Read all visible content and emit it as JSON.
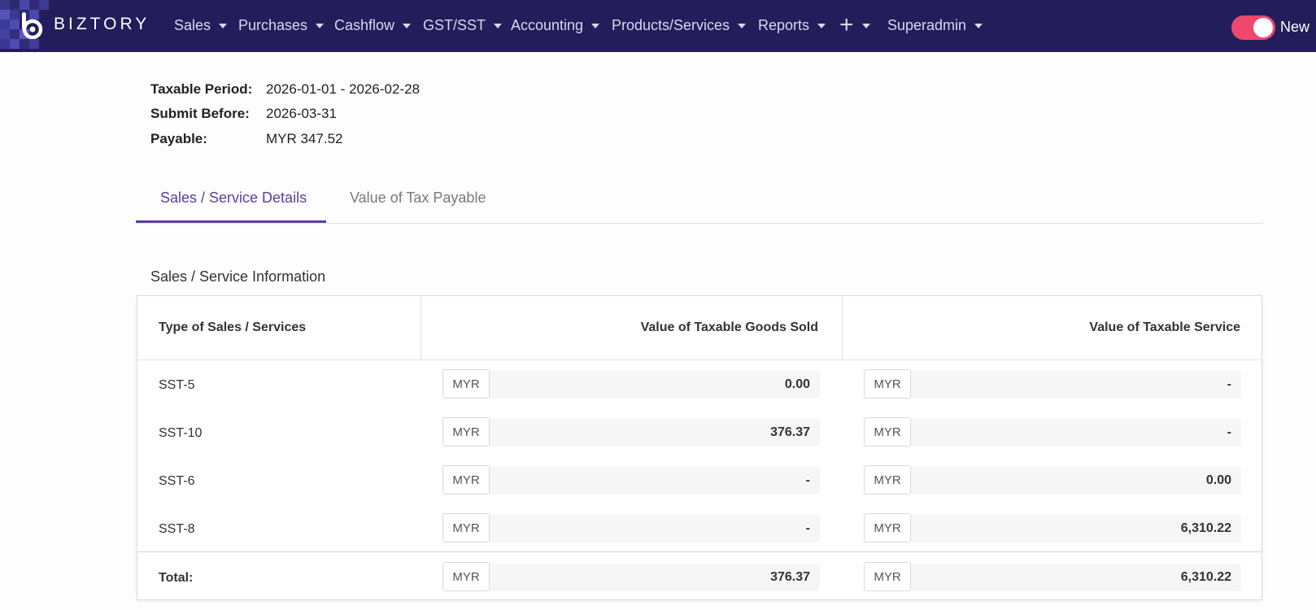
{
  "app": {
    "brand": "BIZTORY"
  },
  "nav": {
    "items": [
      {
        "label": "Sales"
      },
      {
        "label": "Purchases"
      },
      {
        "label": "Cashflow"
      },
      {
        "label": "GST/SST"
      },
      {
        "label": "Accounting"
      },
      {
        "label": "Products/Services"
      },
      {
        "label": "Reports"
      },
      {
        "label": "+"
      },
      {
        "label": "Superadmin"
      }
    ],
    "toggle_label": "New",
    "toggle_on": true
  },
  "summary": {
    "taxable_period_label": "Taxable Period:",
    "taxable_period_value": "2026-01-01 - 2026-02-28",
    "submit_before_label": "Submit Before:",
    "submit_before_value": "2026-03-31",
    "payable_label": "Payable:",
    "payable_value": "MYR 347.52"
  },
  "tabs": [
    {
      "label": "Sales / Service Details",
      "active": true
    },
    {
      "label": "Value of Tax Payable",
      "active": false
    }
  ],
  "section": {
    "title": "Sales / Service Information",
    "columns": [
      "Type of Sales / Services",
      "Value of Taxable Goods Sold",
      "Value of Taxable Service"
    ],
    "currency": "MYR",
    "rows": [
      {
        "type": "SST-5",
        "goods": "0.00",
        "service": "-"
      },
      {
        "type": "SST-10",
        "goods": "376.37",
        "service": "-"
      },
      {
        "type": "SST-6",
        "goods": "-",
        "service": "0.00"
      },
      {
        "type": "SST-8",
        "goods": "-",
        "service": "6,310.22"
      }
    ],
    "total": {
      "label": "Total:",
      "goods": "376.37",
      "service": "6,310.22"
    }
  },
  "colors": {
    "navbar": "#231d5c",
    "accent": "#5b3fa0",
    "toggle": "#f0476c"
  }
}
